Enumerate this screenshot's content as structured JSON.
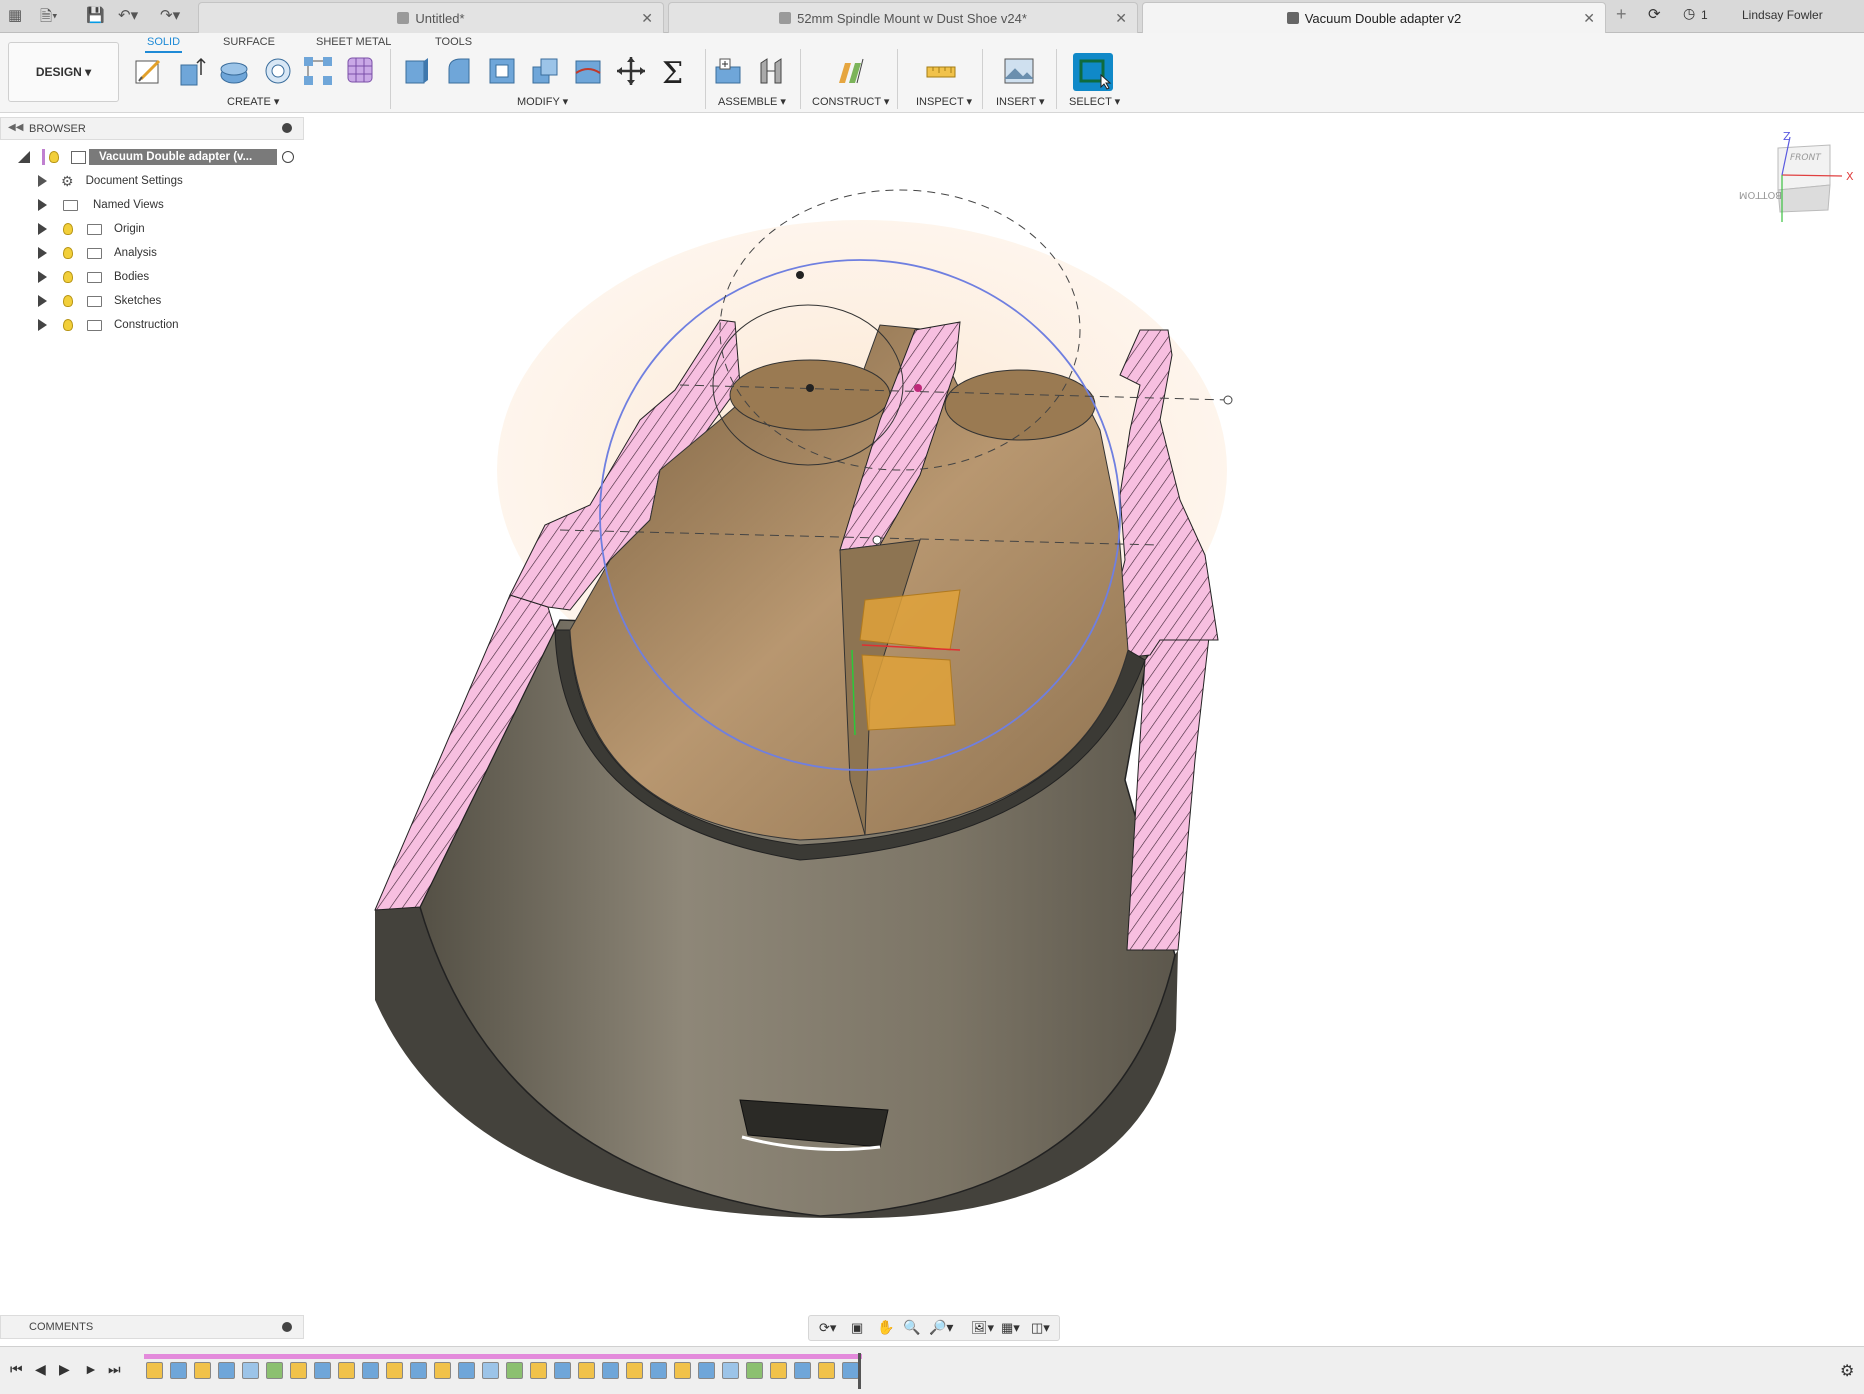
{
  "tabs": [
    {
      "label": "Untitled*",
      "active": false
    },
    {
      "label": "52mm Spindle Mount w Dust Shoe v24*",
      "active": false
    },
    {
      "label": "Vacuum Double adapter v2",
      "active": true
    }
  ],
  "header_right": {
    "job_count": "1",
    "user_name": "Lindsay Fowler"
  },
  "workspace": {
    "label": "DESIGN ▾"
  },
  "ribbon_tabs": [
    {
      "label": "SOLID",
      "active": true
    },
    {
      "label": "SURFACE",
      "active": false
    },
    {
      "label": "SHEET METAL",
      "active": false
    },
    {
      "label": "TOOLS",
      "active": false
    }
  ],
  "tool_groups": [
    {
      "label": "CREATE ▾"
    },
    {
      "label": "MODIFY ▾"
    },
    {
      "label": "ASSEMBLE ▾"
    },
    {
      "label": "CONSTRUCT ▾"
    },
    {
      "label": "INSPECT ▾"
    },
    {
      "label": "INSERT ▾"
    },
    {
      "label": "SELECT ▾"
    }
  ],
  "browser": {
    "title": "BROWSER",
    "root": "Vacuum Double adapter (v...",
    "items": [
      {
        "label": "Document Settings",
        "icon": "gear-icon"
      },
      {
        "label": "Named Views",
        "icon": "folder-icon"
      },
      {
        "label": "Origin",
        "icon": "folder-icon"
      },
      {
        "label": "Analysis",
        "icon": "folder-icon"
      },
      {
        "label": "Bodies",
        "icon": "folder-icon"
      },
      {
        "label": "Sketches",
        "icon": "folder-icon"
      },
      {
        "label": "Construction",
        "icon": "folder-icon"
      }
    ]
  },
  "viewcube": {
    "front": "FRONT",
    "bottom": "BOTTOM",
    "axis_x": "X",
    "axis_z": "Z"
  },
  "comments": {
    "title": "COMMENTS"
  },
  "colors": {
    "accent": "#1e8ad6",
    "section_hatch": "#f4b6d9",
    "model_body": "#7d7566",
    "select_blue": "#1089c8"
  }
}
